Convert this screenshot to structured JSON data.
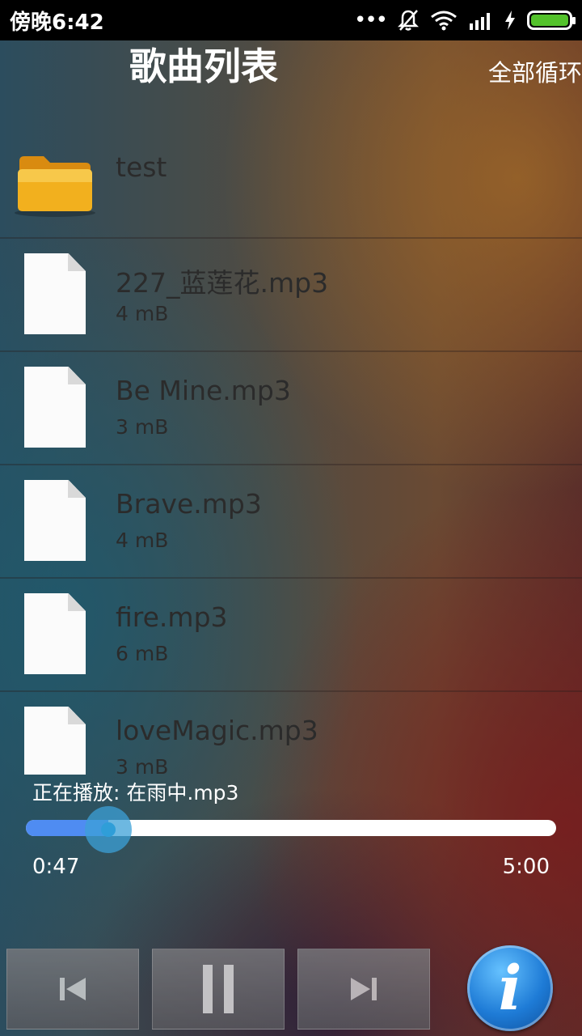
{
  "status_bar": {
    "time": "傍晚6:42",
    "icons": [
      "more-dots-icon",
      "bell-off-icon",
      "wifi-icon",
      "signal-icon",
      "charging-icon",
      "battery-icon"
    ],
    "battery_color": "#53c22b"
  },
  "header": {
    "title": "歌曲列表",
    "loop_mode": "全部循环"
  },
  "folder": {
    "name": "test",
    "icon": "folder-icon"
  },
  "files": [
    {
      "name": "227_蓝莲花.mp3",
      "size": "4 mB"
    },
    {
      "name": "Be Mine.mp3",
      "size": "3 mB"
    },
    {
      "name": "Brave.mp3",
      "size": "4 mB"
    },
    {
      "name": "fire.mp3",
      "size": "6 mB"
    },
    {
      "name": "loveMagic.mp3",
      "size": "3 mB"
    }
  ],
  "player": {
    "now_playing": "正在播放: 在雨中.mp3",
    "elapsed": "0:47",
    "total": "5:00",
    "progress": 0.156,
    "progress_color": "#4f8cf2"
  },
  "controls": {
    "prev_icon": "skip-previous-icon",
    "pause_icon": "pause-icon",
    "next_icon": "skip-next-icon",
    "info_icon": "info-icon",
    "info_label": "i"
  }
}
